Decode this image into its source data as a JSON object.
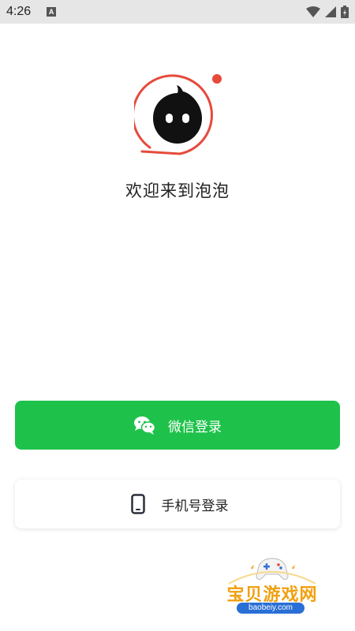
{
  "status_bar": {
    "time": "4:26",
    "notification_letter": "A",
    "icons": [
      "wifi-icon",
      "cell-signal-icon",
      "battery-icon"
    ]
  },
  "logo": {
    "ring_color": "#e64a3b",
    "face_color": "#111111",
    "dot_color": "#e64a3b"
  },
  "welcome_text": "欢迎来到泡泡",
  "buttons": {
    "wechat": {
      "label": "微信登录",
      "icon": "wechat-icon",
      "color": "#1ec24a"
    },
    "phone": {
      "label": "手机号登录",
      "icon": "phone-icon"
    }
  },
  "watermark": {
    "title": "宝贝游戏网",
    "url": "baobeiy.com"
  }
}
